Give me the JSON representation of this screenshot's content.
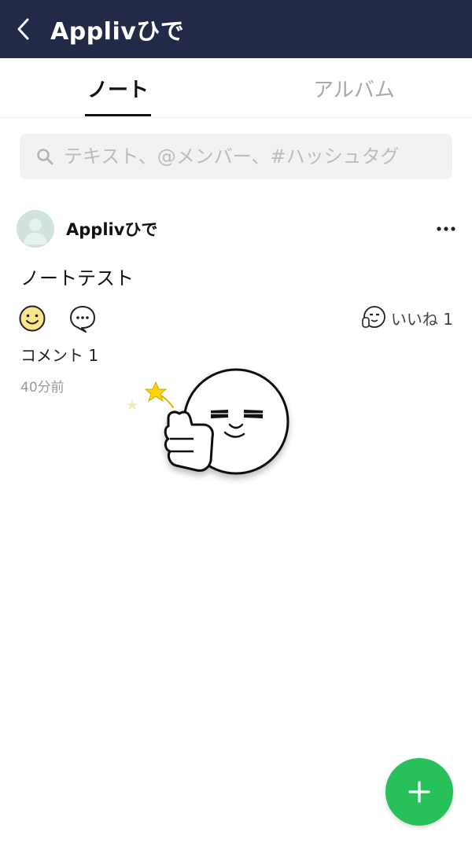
{
  "header": {
    "title": "Applivひで"
  },
  "tabs": [
    {
      "label": "ノート",
      "active": true
    },
    {
      "label": "アルバム",
      "active": false
    }
  ],
  "search": {
    "placeholder": "テキスト、@メンバー、#ハッシュタグ",
    "value": ""
  },
  "post": {
    "author": "Applivひで",
    "text": "ノートテスト",
    "like_label": "いいね 1",
    "comment_label": "コメント 1",
    "time": "40分前"
  },
  "icons": {
    "back": "chevron-left-icon",
    "search": "search-icon",
    "more": "more-horizontal-icon",
    "react": "smiley-icon",
    "comment": "chat-bubble-icon",
    "like": "sticker-face-icon",
    "fab": "plus-icon"
  },
  "colors": {
    "header_bg": "#232a47",
    "fab_bg": "#28c05a",
    "avatar_bg": "#cfe3dc",
    "tab_inactive": "#a9a9a9"
  }
}
